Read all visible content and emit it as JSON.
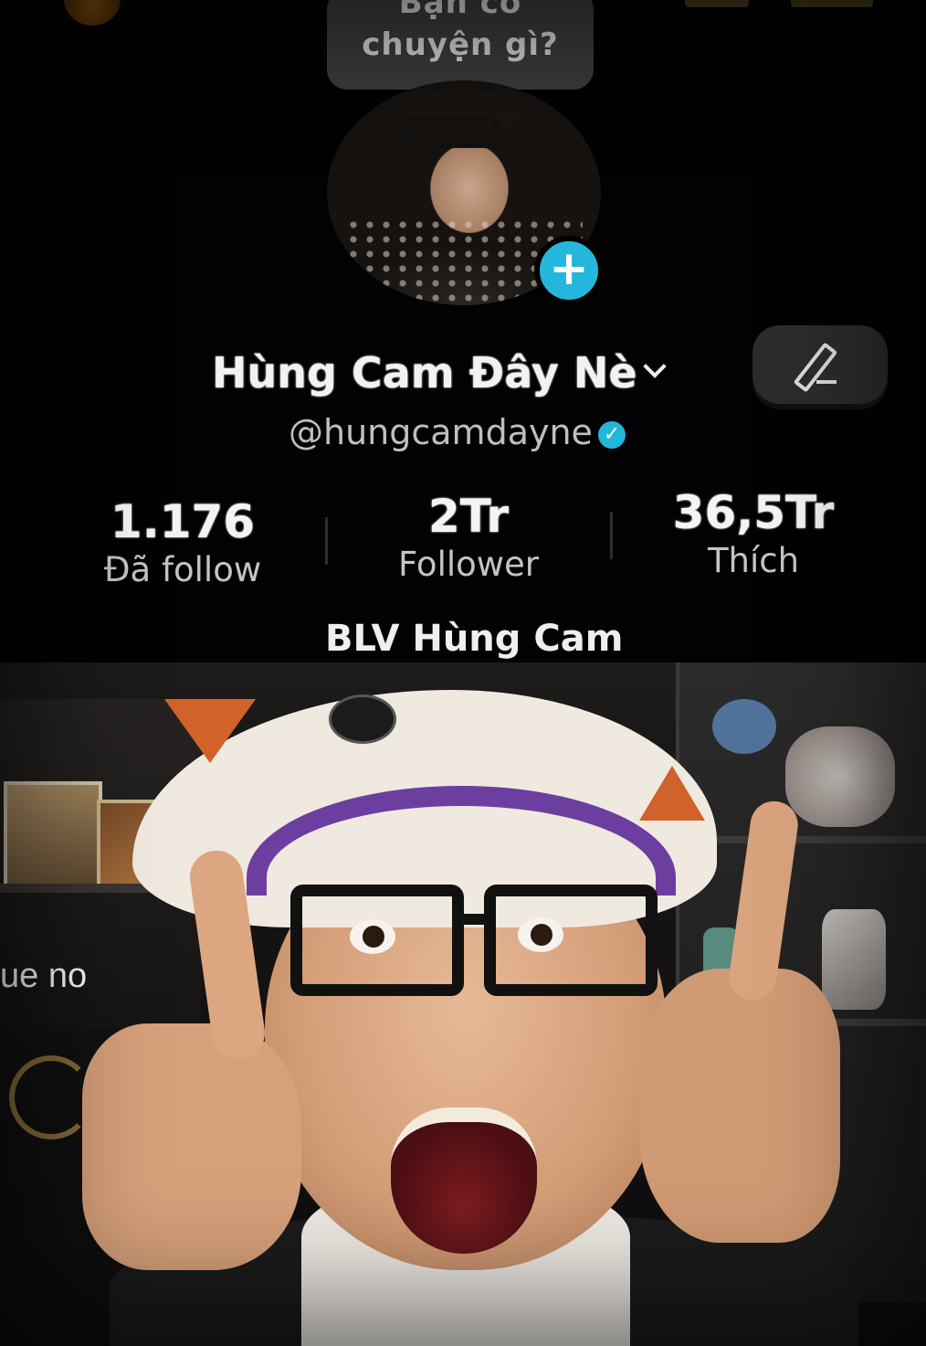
{
  "speech_bubble": {
    "line1": "Bạn có",
    "line2": "chuyện gì?"
  },
  "profile": {
    "display_name": "Hùng Cam Đây Nè",
    "handle": "@hungcamdayne",
    "verified_icon": "✓",
    "add_icon": "+",
    "stats": {
      "following_value": "1.176",
      "following_label": "Đã follow",
      "followers_value": "2Tr",
      "followers_label": "Follower",
      "likes_value": "36,5Tr",
      "likes_label": "Thích"
    },
    "bio_name": "BLV Hùng Cam"
  },
  "caption": {
    "text": "ue no"
  },
  "colors": {
    "accent": "#25b7db",
    "background": "#000000"
  }
}
